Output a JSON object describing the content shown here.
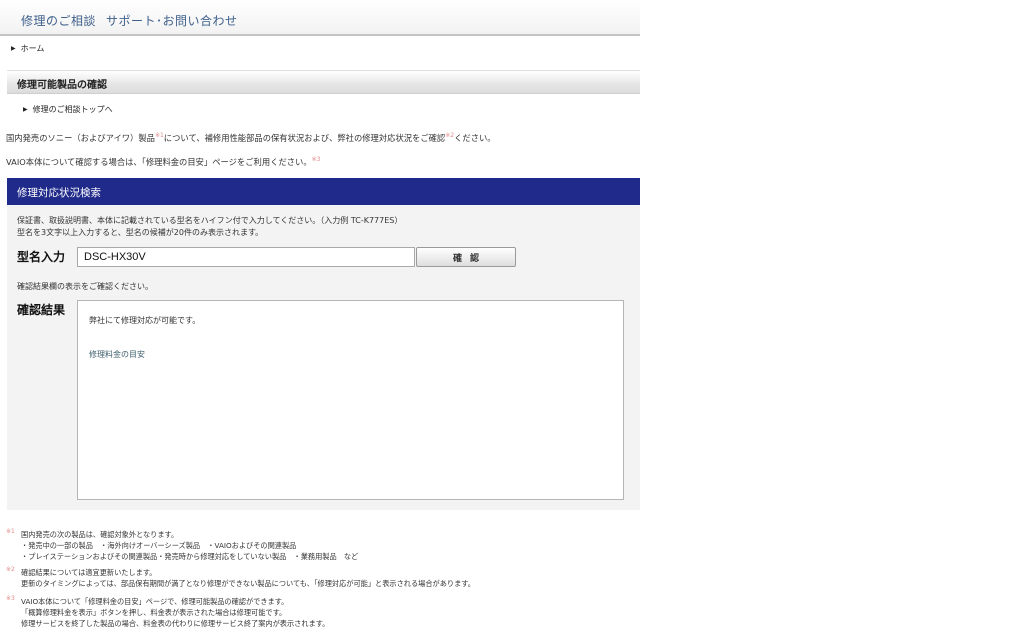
{
  "header": {
    "title": "修理のご相談",
    "subtitle": "サポート･お問い合わせ"
  },
  "breadcrumb": {
    "home": "ホーム"
  },
  "section": {
    "heading": "修理可能製品の確認",
    "top_link": "修理のご相談トップへ"
  },
  "intro": {
    "line1_a": "国内発売のソニー（およびアイワ）製品",
    "line1_note1": "※1",
    "line1_b": "について、補修用性能部品の保有状況および、弊社の修理対応状況をご確認",
    "line1_note2": "※2",
    "line1_c": "ください。",
    "line2_a": "VAIO本体について確認する場合は、「修理料金の目安」ページをご利用ください。",
    "line2_note3": "※3"
  },
  "search": {
    "heading": "修理対応状況検索",
    "guide_line1": "保証書、取扱説明書、本体に記載されている型名をハイフン付で入力してください。（入力例 TC-K777ES）",
    "guide_line2": "型名を3文字以上入力すると、型名の候補が20件のみ表示されます。",
    "model_label": "型名入力",
    "model_value": "DSC-HX30V",
    "confirm_label": "確認",
    "check_note": "確認結果欄の表示をご確認ください。",
    "result_label": "確認結果",
    "result_message": "弊社にて修理対応が可能です。",
    "result_link": "修理料金の目安"
  },
  "footnotes": {
    "n1_mark": "※1",
    "n1_l1": "国内発売の次の製品は、確認対象外となります。",
    "n1_l2": "・発売中の一部の製品　・海外向けオーバーシーズ製品　・VAIOおよびその関連製品",
    "n1_l3": "・プレイステーションおよびその関連製品・発売時から修理対応をしていない製品　・業務用製品　など",
    "n2_mark": "※2",
    "n2_l1": "確認結果については適宜更新いたします。",
    "n2_l2": "更新のタイミングによっては、部品保有期間が満了となり修理ができない製品についても、「修理対応が可能」と表示される場合があります。",
    "n3_mark": "※3",
    "n3_l1": "VAIO本体について「修理料金の目安」ページで、修理可能製品の確認ができます。",
    "n3_l2": "「概算修理料金を表示」ボタンを押し、料金表が表示された場合は修理可能です。",
    "n3_l3": "修理サービスを終了した製品の場合、料金表の代わりに修理サービス終了案内が表示されます。"
  }
}
